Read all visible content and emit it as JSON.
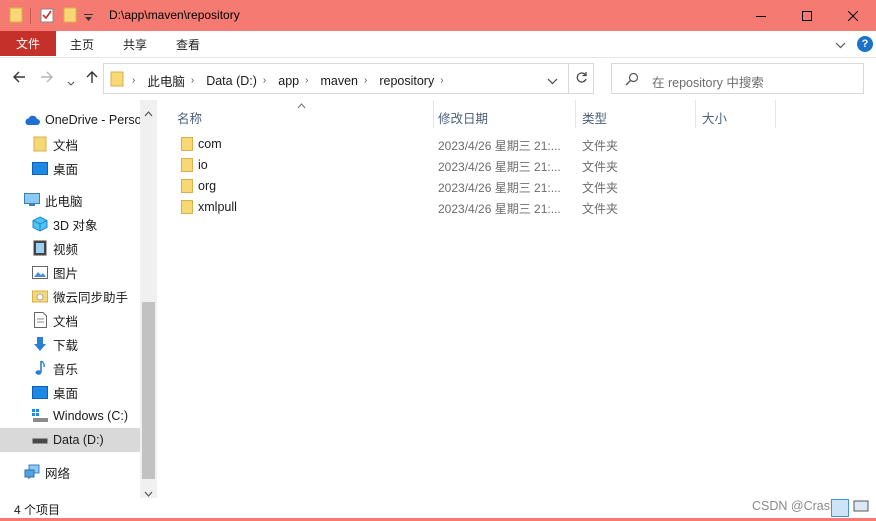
{
  "titlebar": {
    "path": "D:\\app\\maven\\repository",
    "minimize_icon": "minimize-icon",
    "maximize_icon": "maximize-icon",
    "close_icon": "close-icon"
  },
  "ribbon": {
    "file_label": "文件",
    "tabs": [
      "主页",
      "共享",
      "查看"
    ],
    "help_label": "?"
  },
  "address": {
    "crumbs": [
      "此电脑",
      "Data (D:)",
      "app",
      "maven",
      "repository"
    ]
  },
  "search": {
    "placeholder": "在 repository 中搜索"
  },
  "sidebar": {
    "items": [
      {
        "label": "OneDrive - Perso",
        "icon": "cloud-icon"
      },
      {
        "label": "文档",
        "icon": "folder-icon"
      },
      {
        "label": "桌面",
        "icon": "desktop-icon"
      },
      {
        "label": "此电脑",
        "icon": "computer-icon"
      },
      {
        "label": "3D 对象",
        "icon": "cube-icon"
      },
      {
        "label": "视频",
        "icon": "video-icon"
      },
      {
        "label": "图片",
        "icon": "picture-icon"
      },
      {
        "label": "微云同步助手",
        "icon": "weiyun-icon"
      },
      {
        "label": "文档",
        "icon": "document-icon"
      },
      {
        "label": "下载",
        "icon": "download-icon"
      },
      {
        "label": "音乐",
        "icon": "music-icon"
      },
      {
        "label": "桌面",
        "icon": "desktop-icon"
      },
      {
        "label": "Windows (C:)",
        "icon": "windows-drive-icon"
      },
      {
        "label": "Data (D:)",
        "icon": "drive-icon"
      },
      {
        "label": "网络",
        "icon": "network-icon"
      }
    ]
  },
  "columns": {
    "name": "名称",
    "date": "修改日期",
    "type": "类型",
    "size": "大小"
  },
  "files": [
    {
      "name": "com",
      "date": "2023/4/26 星期三 21:...",
      "type": "文件夹"
    },
    {
      "name": "io",
      "date": "2023/4/26 星期三 21:...",
      "type": "文件夹"
    },
    {
      "name": "org",
      "date": "2023/4/26 星期三 21:...",
      "type": "文件夹"
    },
    {
      "name": "xmlpull",
      "date": "2023/4/26 星期三 21:...",
      "type": "文件夹"
    }
  ],
  "status": {
    "count": "4 个项目",
    "watermark": "CSDN @Crashcc"
  },
  "colors": {
    "titlebar": "#f57b72",
    "file_tab": "#c6302a",
    "folder": "#f8d775",
    "selected": "#d9d9d9"
  }
}
